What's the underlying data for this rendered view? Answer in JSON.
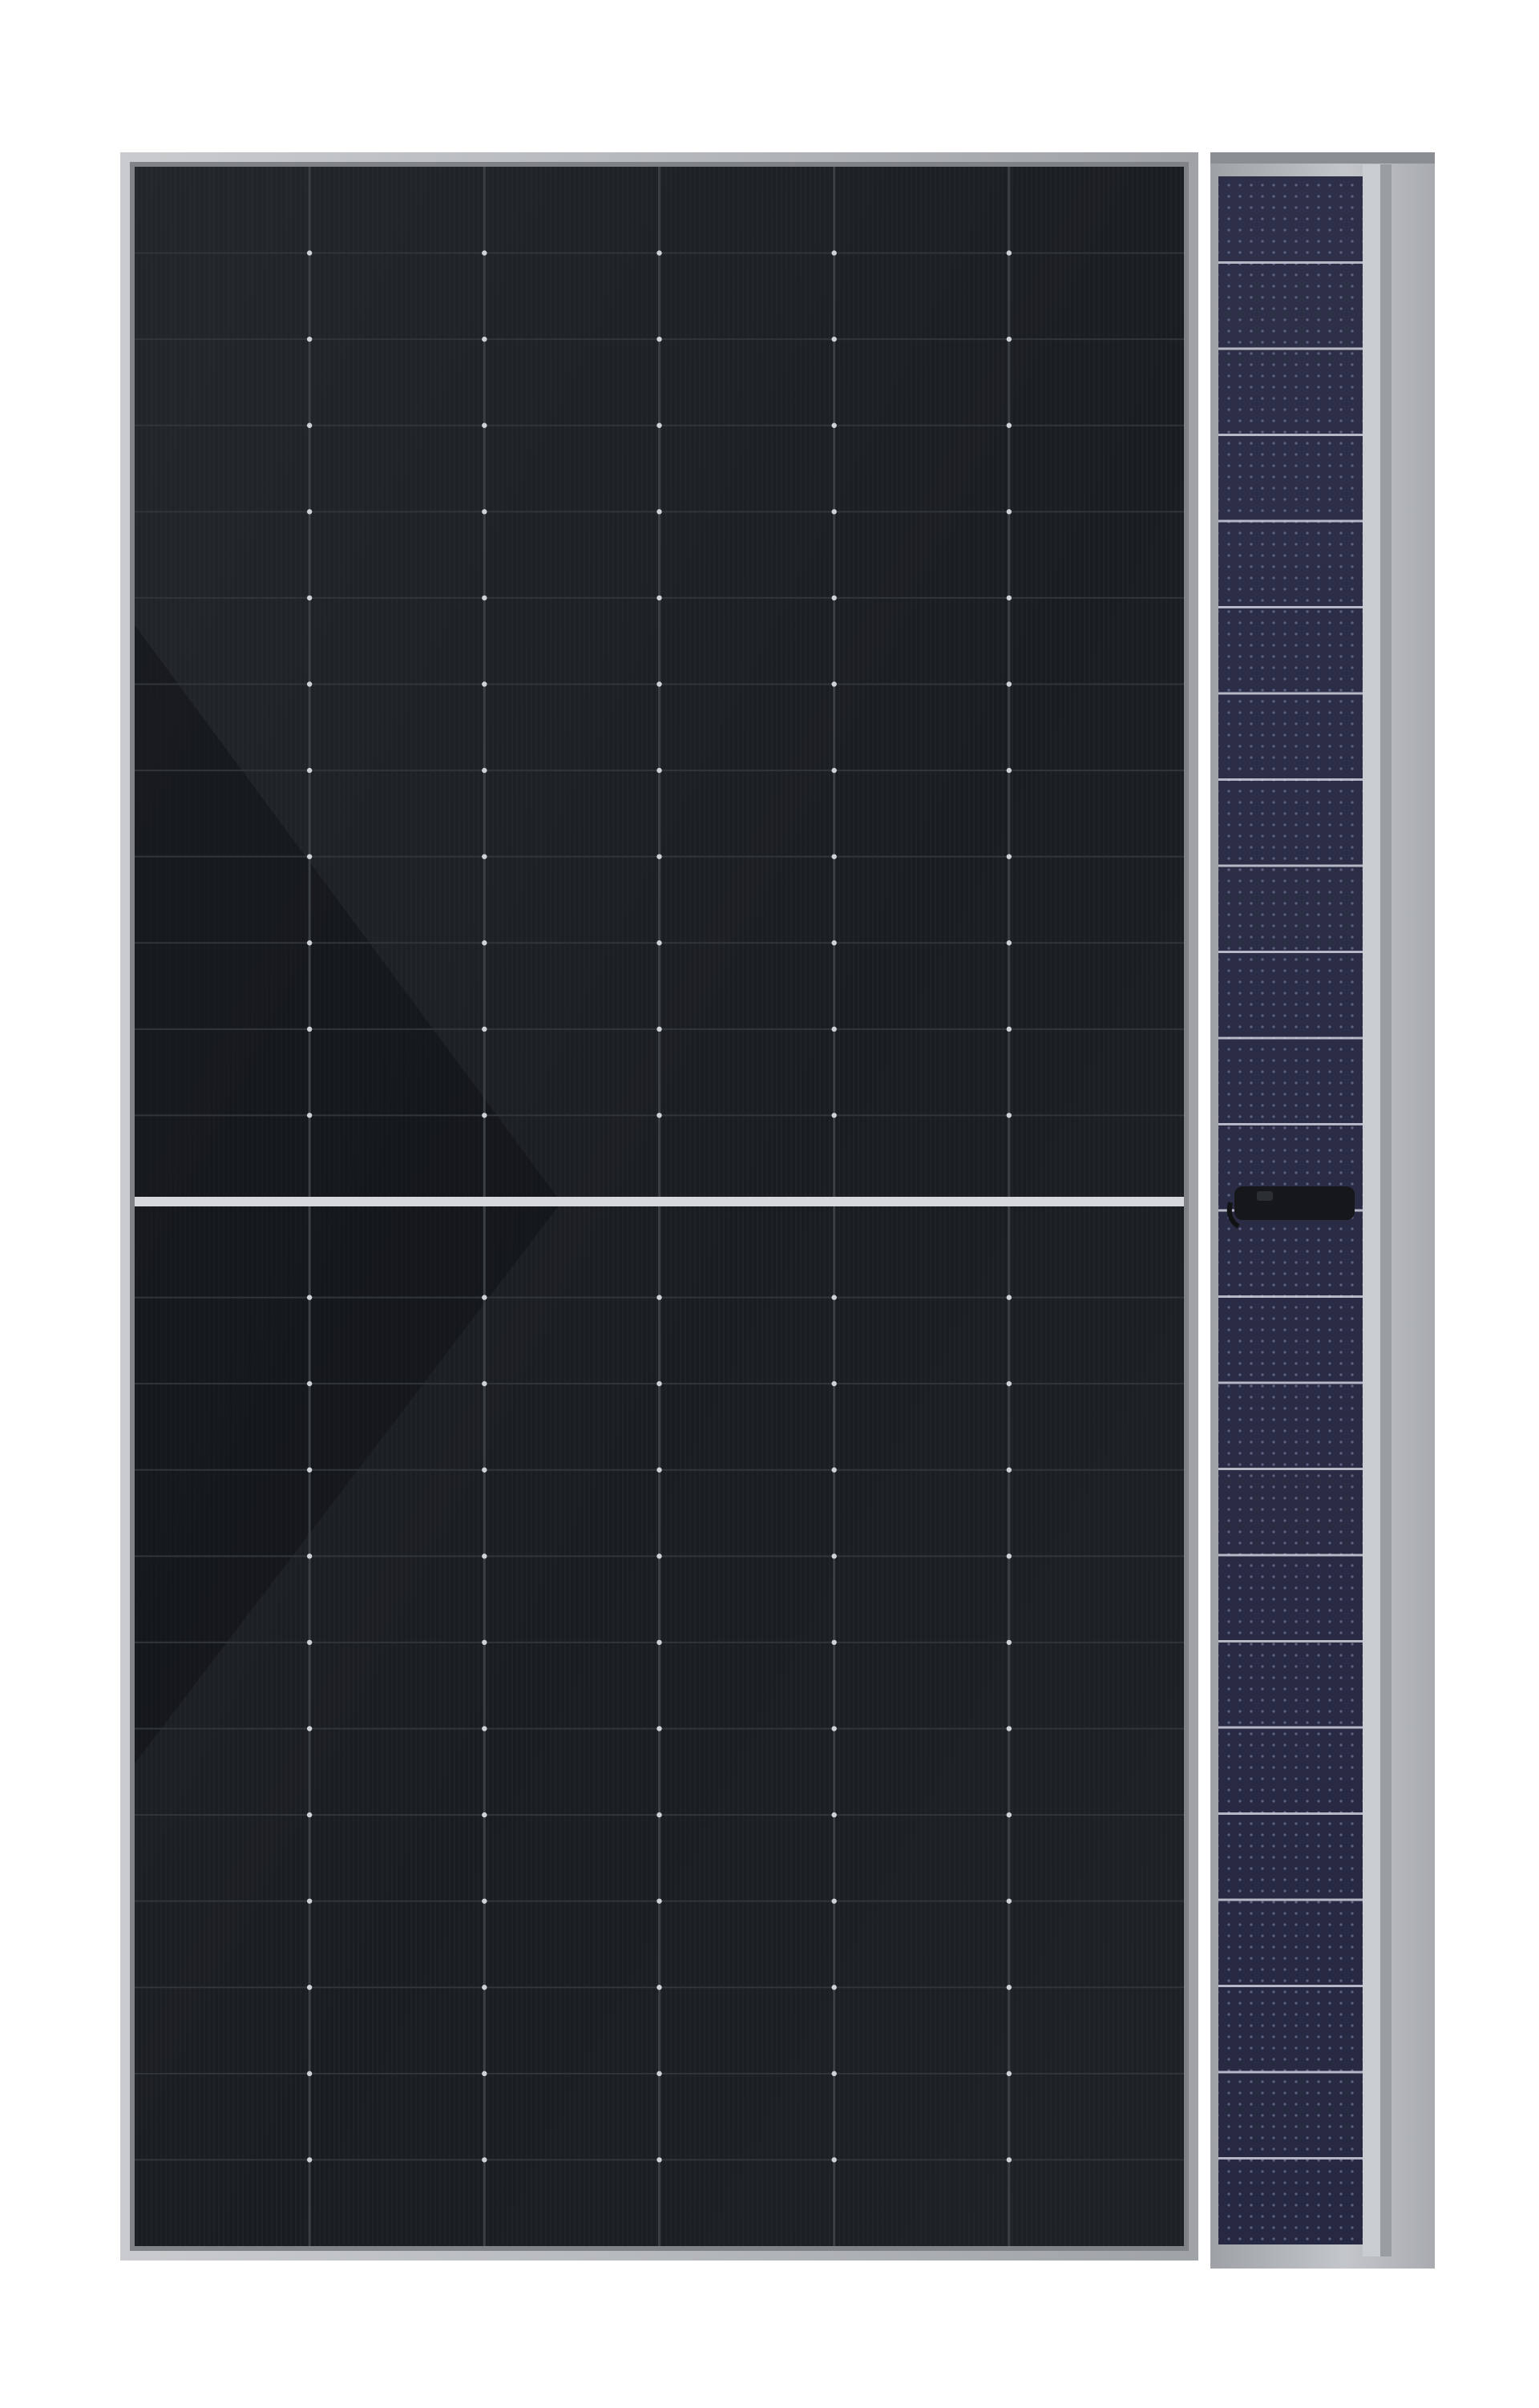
{
  "scene": {
    "subject": "solar-panel",
    "front_panel": {
      "cell_columns": 6,
      "cell_rows_per_half": 12,
      "halves": 2
    },
    "rear_panel": {
      "cell_rows_per_half": 12,
      "halves": 2
    },
    "colors": {
      "background": "#ffffff",
      "frame": "#b8bbbf",
      "frame_shadow": "#8e9196",
      "front_glass": "#1b1e21",
      "front_cell": "#1f2326",
      "front_grid_line": "#cfd3d6",
      "front_reflection": "#0c0e10",
      "rear_glass": "#2a2c45",
      "rear_grid_line": "#d8dae6",
      "rear_frame": "#b2b5ba",
      "junction_box": "#15171a"
    }
  }
}
